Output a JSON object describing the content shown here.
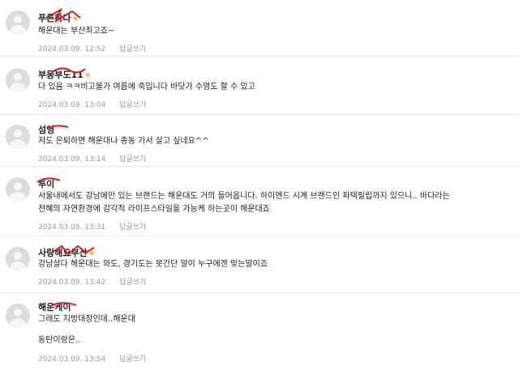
{
  "reply_label": "답글쓰기",
  "comments": [
    {
      "nickname": "푸른하다",
      "badge": "★",
      "text": "해운대는 부산최고죠~",
      "date": "2024.03.09.",
      "time": "12:52"
    },
    {
      "nickname": "부동부도11",
      "badge": "★",
      "text": "다 있음 ㅋㅋ비고불가 여름에 죽입니다 바닷가 수영도 할 수 있고",
      "date": "2024.03.09.",
      "time": "13:04"
    },
    {
      "nickname": "섬영",
      "text": "저도 은퇴하면 해운대나 종동 가서 살고 싶네요^^",
      "date": "2024.03.09.",
      "time": "13:14"
    },
    {
      "nickname": "투이",
      "text_line1": "서울내에서도 강남에만 있는 브랜드는 해운대도 거의 들어옵니다. 하이엔드 시계 브랜드인 파텍필립까지 있으니.. 바다라는",
      "text_line2": "천혜의 자연환경에 감각적 라이프스타일을 가능케 하는곳이 해운대죠",
      "date": "2024.03.09.",
      "time": "13:31"
    },
    {
      "nickname": "사랑해요부산",
      "badge": "★",
      "text": "강남살다 해운대는 와도, 경기도는 못간단 말이 누구에겐 맞는말이죠",
      "date": "2024.03.09.",
      "time": "13:42"
    },
    {
      "nickname": "해운케이",
      "text_line1": "그래도 지방대장인데..해운대",
      "text_line2": "동탄이랑은..",
      "date": "2024.03.09.",
      "time": "13:54"
    }
  ]
}
